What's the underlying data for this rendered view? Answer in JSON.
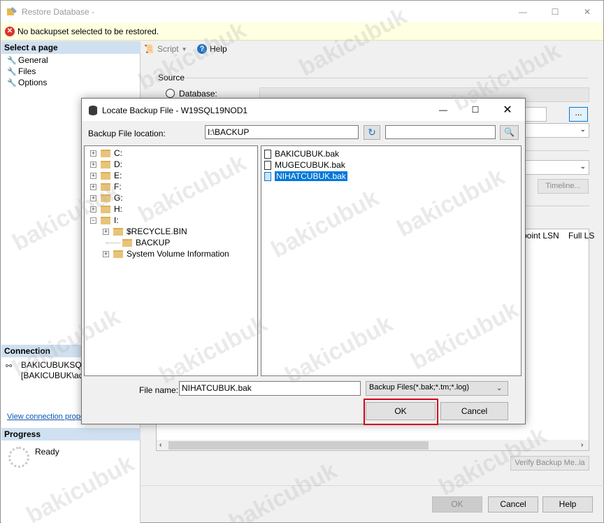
{
  "window": {
    "title": "Restore Database -",
    "minimize": "—",
    "maximize": "☐",
    "close": "✕"
  },
  "warning": {
    "text": "No backupset selected to be restored."
  },
  "left_panel": {
    "select_page": "Select a page",
    "pages": [
      "General",
      "Files",
      "Options"
    ],
    "connection_header": "Connection",
    "connection_server": "BAKICUBUKSQLA",
    "connection_user": "[BAKICUBUK\\adm",
    "connection_link": "View connection prope",
    "progress_header": "Progress",
    "progress_status": "Ready"
  },
  "toolbar": {
    "script_label": "Script",
    "help_label": "Help"
  },
  "source": {
    "label": "Source",
    "database_label": "Database:"
  },
  "background": {
    "browse_label": "...",
    "timeline_label": "Timeline...",
    "grid_col_1": "point LSN",
    "grid_col_2": "Full LS",
    "verify_label": "Verify Backup Me..ia"
  },
  "footer": {
    "ok_label": "OK",
    "cancel_label": "Cancel",
    "help_label": "Help"
  },
  "dialog": {
    "title": "Locate Backup File - W19SQL19NOD1",
    "minimize": "—",
    "maximize": "☐",
    "close": "✕",
    "location_label": "Backup File location:",
    "location_value": "I:\\BACKUP",
    "search_value": "",
    "tree": [
      {
        "label": "C:",
        "expander": "+",
        "level": 0
      },
      {
        "label": "D:",
        "expander": "+",
        "level": 0
      },
      {
        "label": "E:",
        "expander": "+",
        "level": 0
      },
      {
        "label": "F:",
        "expander": "+",
        "level": 0
      },
      {
        "label": "G:",
        "expander": "+",
        "level": 0
      },
      {
        "label": "H:",
        "expander": "+",
        "level": 0
      },
      {
        "label": "I:",
        "expander": "−",
        "level": 0
      },
      {
        "label": "$RECYCLE.BIN",
        "expander": "+",
        "level": 1
      },
      {
        "label": "BACKUP",
        "expander": "",
        "level": 1
      },
      {
        "label": "System Volume Information",
        "expander": "+",
        "level": 1
      }
    ],
    "files": [
      {
        "name": "BAKICUBUK.bak",
        "selected": false
      },
      {
        "name": "MUGECUBUK.bak",
        "selected": false
      },
      {
        "name": "NIHATCUBUK.bak",
        "selected": true
      }
    ],
    "file_name_label": "File name:",
    "file_name_value": "NIHATCUBUK.bak",
    "file_type": "Backup Files(*.bak;*.tm;*.log)",
    "ok_label": "OK",
    "cancel_label": "Cancel"
  },
  "watermark": "bakicubuk",
  "colors": {
    "accent": "#0078d7",
    "highlight_border": "#d0021b",
    "warning_bg": "#ffffe1",
    "panel_header": "#cfe0f0"
  }
}
